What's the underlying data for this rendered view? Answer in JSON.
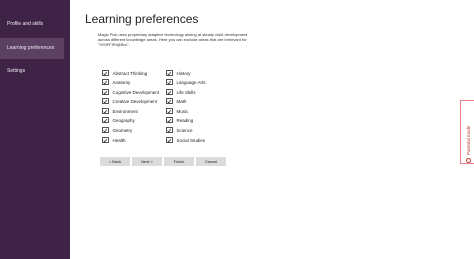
{
  "sidebar": {
    "items": [
      {
        "label": "Profile and skills"
      },
      {
        "label": "Learning preferences"
      },
      {
        "label": "Settings"
      }
    ]
  },
  "main": {
    "title": "Learning preferences",
    "description": "Magic Pick uses proprietary adaptive technology aiming at steady child development across different knowledge areas. Here you can exclude areas that are irrelevant for \"%SIFFIRI@Bru\".",
    "preferences_left": [
      {
        "label": "Abstract Thinking",
        "checked": true
      },
      {
        "label": "Anatomy",
        "checked": true
      },
      {
        "label": "Cognitive Development",
        "checked": true
      },
      {
        "label": "Creative Development",
        "checked": true
      },
      {
        "label": "Environment",
        "checked": true
      },
      {
        "label": "Geography",
        "checked": true
      },
      {
        "label": "Geometry",
        "checked": true
      },
      {
        "label": "Health",
        "checked": true
      }
    ],
    "preferences_right": [
      {
        "label": "History",
        "checked": true
      },
      {
        "label": "Language Arts",
        "checked": true
      },
      {
        "label": "Life Skills",
        "checked": true
      },
      {
        "label": "Math",
        "checked": true
      },
      {
        "label": "Music",
        "checked": true
      },
      {
        "label": "Reading",
        "checked": true
      },
      {
        "label": "Science",
        "checked": true
      },
      {
        "label": "Social Studies",
        "checked": true
      }
    ],
    "buttons": {
      "back": "< Back",
      "next": "Next >",
      "finish": "Finish",
      "cancel": "Cancel"
    }
  },
  "parental_mode": {
    "label": "Parental mode",
    "icon": "parental-icon"
  },
  "colors": {
    "sidebar_bg": "#3e2346",
    "sidebar_active": "#5b4062",
    "parental_accent": "#c0392b"
  }
}
